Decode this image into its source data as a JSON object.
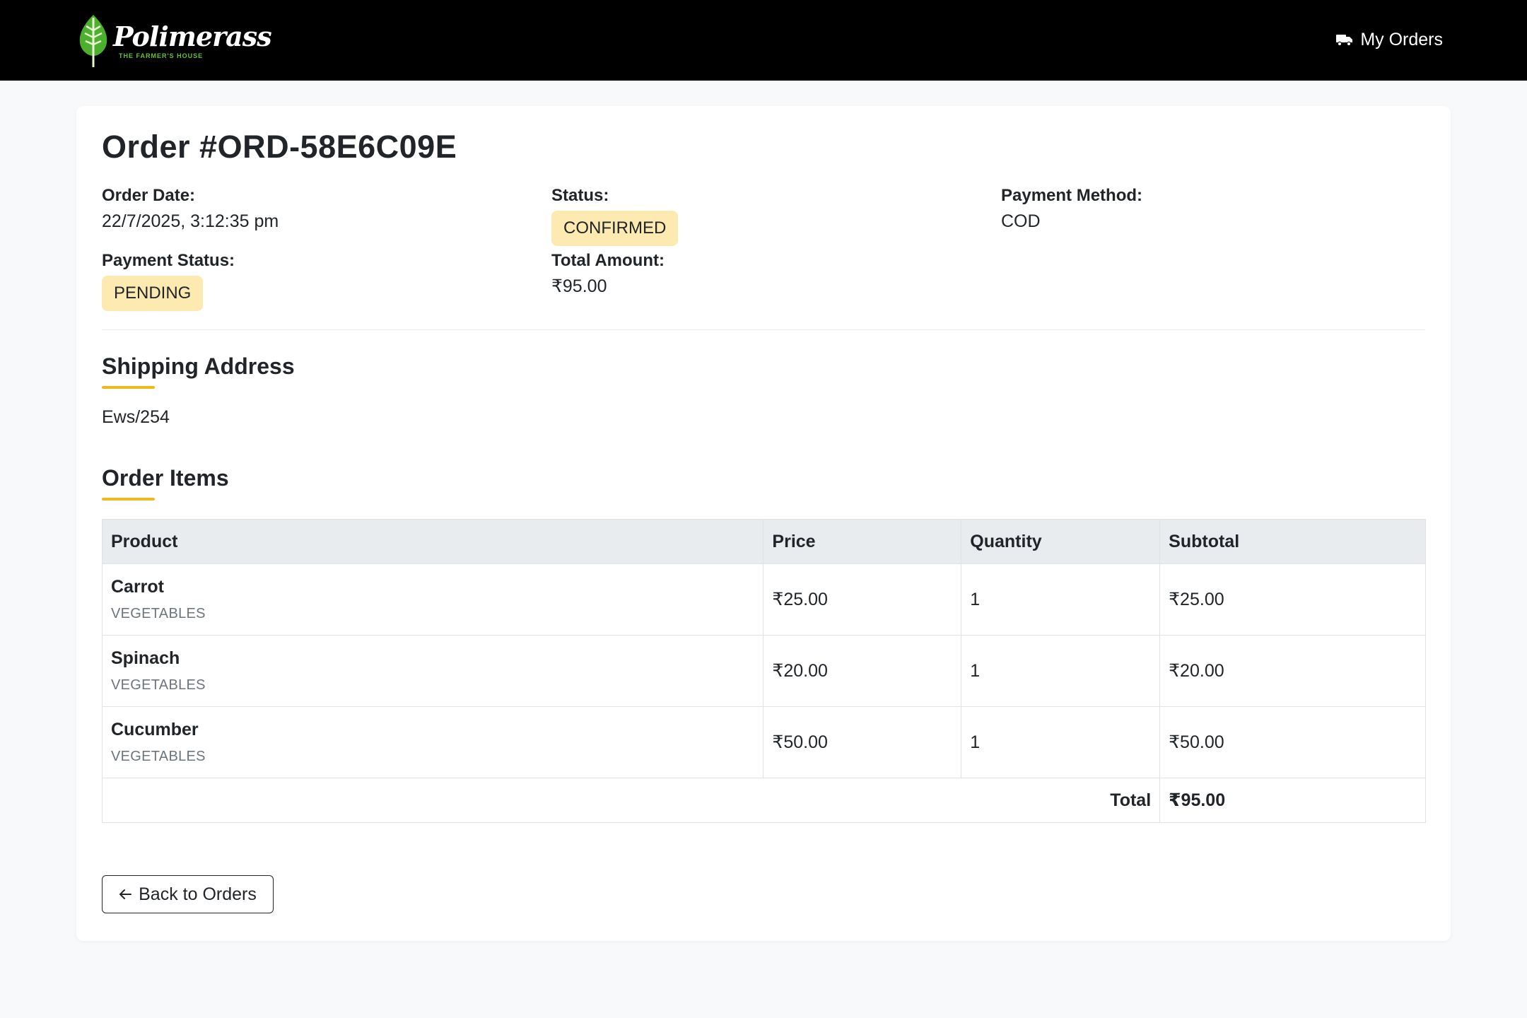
{
  "nav": {
    "brand_name": "Polimerass",
    "brand_tagline": "THE FARMER'S HOUSE",
    "my_orders_label": "My Orders",
    "my_orders_icon": "truck-icon"
  },
  "order": {
    "title": "Order #ORD-58E6C09E",
    "order_date_label": "Order Date:",
    "order_date": "22/7/2025, 3:12:35 pm",
    "status_label": "Status:",
    "status": "CONFIRMED",
    "payment_method_label": "Payment Method:",
    "payment_method": "COD",
    "payment_status_label": "Payment Status:",
    "payment_status": "PENDING",
    "total_amount_label": "Total Amount:",
    "total_amount": "₹95.00"
  },
  "shipping": {
    "heading": "Shipping Address",
    "address": "Ews/254"
  },
  "items": {
    "heading": "Order Items",
    "columns": [
      "Product",
      "Price",
      "Quantity",
      "Subtotal"
    ],
    "rows": [
      {
        "name": "Carrot",
        "category": "VEGETABLES",
        "price": "₹25.00",
        "quantity": "1",
        "subtotal": "₹25.00"
      },
      {
        "name": "Spinach",
        "category": "VEGETABLES",
        "price": "₹20.00",
        "quantity": "1",
        "subtotal": "₹20.00"
      },
      {
        "name": "Cucumber",
        "category": "VEGETABLES",
        "price": "₹50.00",
        "quantity": "1",
        "subtotal": "₹50.00"
      }
    ],
    "total_label": "Total",
    "total_value": "₹95.00"
  },
  "actions": {
    "back_label": "Back to Orders"
  },
  "colors": {
    "navbar": "#000000",
    "badge_bg": "#fdeab0",
    "accent_underline": "#f0b91b",
    "brand_green": "#6cbf3a"
  }
}
